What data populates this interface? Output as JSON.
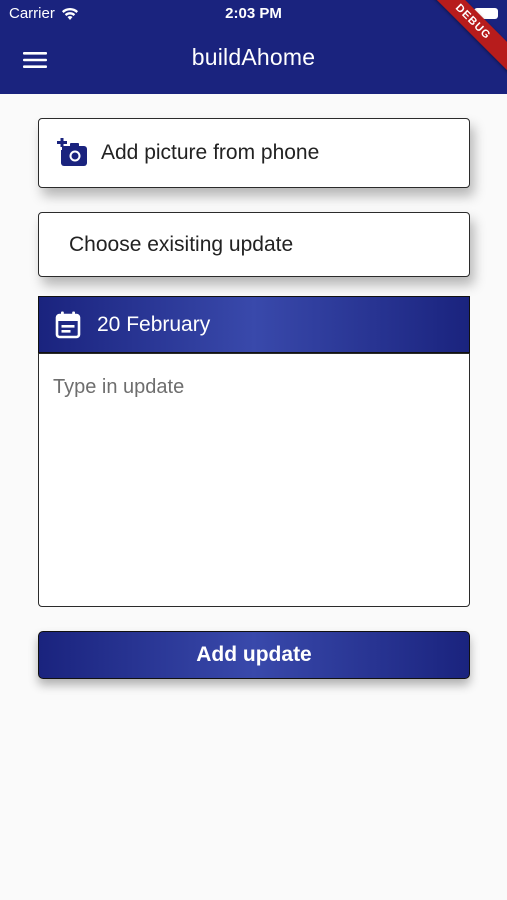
{
  "status_bar": {
    "carrier": "Carrier",
    "time": "2:03 PM"
  },
  "app_bar": {
    "title": "buildAhome",
    "debug_label": "DEBUG",
    "color": "#1a237e"
  },
  "add_picture": {
    "label": "Add picture from phone",
    "icon": "add-photo-icon"
  },
  "choose_update": {
    "label": "Choose exisiting update"
  },
  "date_bar": {
    "date": "20 February",
    "icon": "calendar-icon"
  },
  "update_input": {
    "value": "",
    "placeholder": "Type in update"
  },
  "submit": {
    "label": "Add update"
  }
}
